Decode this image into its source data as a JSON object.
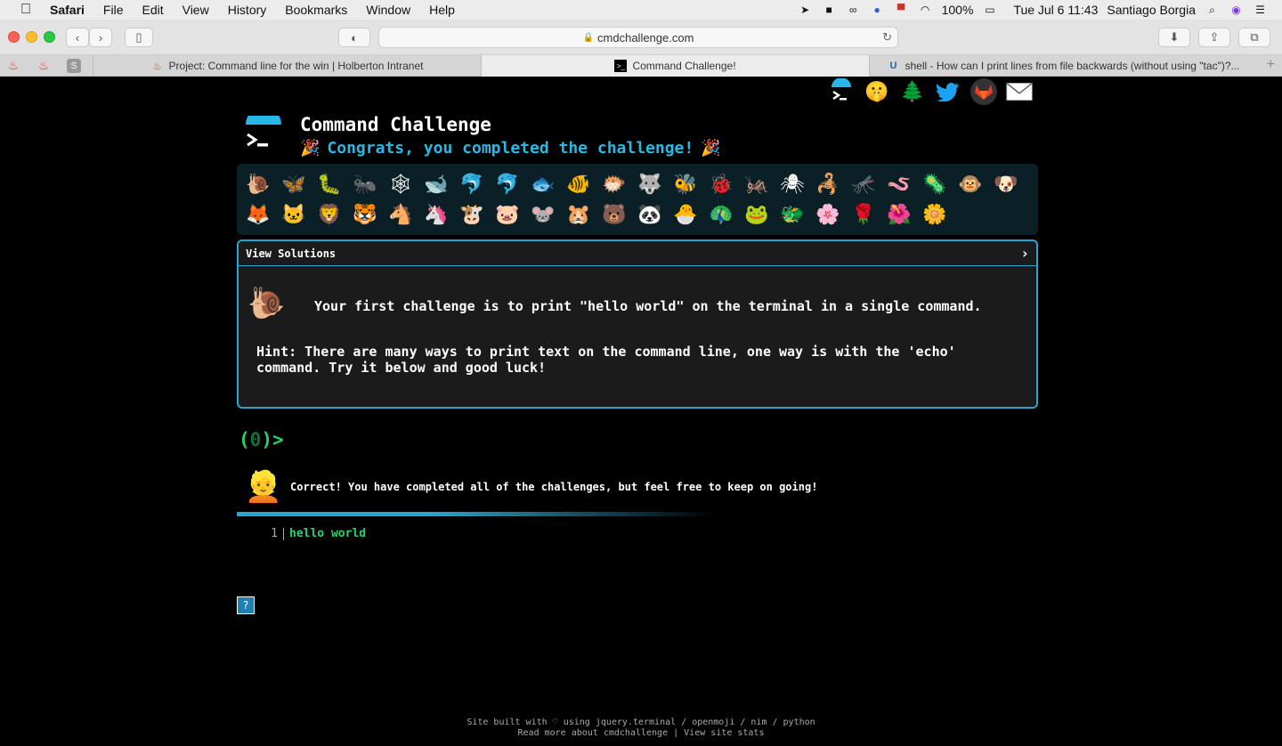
{
  "menubar": {
    "app": "Safari",
    "items": [
      "File",
      "Edit",
      "View",
      "History",
      "Bookmarks",
      "Window",
      "Help"
    ],
    "battery": "100%",
    "datetime": "Tue Jul 6  11:43",
    "user": "Santiago Borgia"
  },
  "toolbar": {
    "url": "cmdchallenge.com"
  },
  "tabs": [
    {
      "label": "Project: Command line for the win | Holberton Intranet"
    },
    {
      "label": "Command Challenge!"
    },
    {
      "label": "shell - How can I print lines from file backwards (without using \"tac\")?..."
    }
  ],
  "page": {
    "title": "Command Challenge",
    "congrats": "Congrats, you completed the challenge!",
    "animals_row1": [
      "🐌",
      "🦋",
      "🐛",
      "🐜",
      "🕸",
      "🐋",
      "🐬",
      "🐬",
      "🐟",
      "🐠",
      "🐡",
      "🐺",
      "🐝",
      "🐞",
      "🦗",
      "🕷",
      "🦂",
      "🦟",
      "🪱",
      "🦠",
      "🐵",
      "🐶"
    ],
    "animals_row2": [
      "🦊",
      "🐱",
      "🦁",
      "🐯",
      "🐴",
      "🦄",
      "🐮",
      "🐷",
      "🐭",
      "🐹",
      "🐻",
      "🐼",
      "🐣",
      "🦚",
      "🐸",
      "🐲",
      "🌸",
      "🌹",
      "🌺",
      "🌼"
    ],
    "solutions": {
      "header": "View Solutions",
      "chevron": "›",
      "challenge": "Your first challenge is to print \"hello world\" on the terminal in a single command.",
      "hint": "Hint: There are many ways to print text on the command line, one way is with the 'echo' command. Try it below and good luck!"
    },
    "prompt": {
      "open": "(",
      "num": "0",
      "close": ")>"
    },
    "feedback": "Correct! You have completed all of the challenges, but feel free to keep on going!",
    "output": {
      "line_no": "1",
      "text": "hello world"
    },
    "help_label": "?",
    "footer": {
      "line1": "Site built with ♡ using jquery.terminal / openmoji / nim / python",
      "line2": "Read more about cmdchallenge | View site stats"
    }
  },
  "colors": {
    "accent": "#2aa7d0",
    "prompt_green": "#23d36b",
    "congrats_blue": "#27b9e6"
  }
}
